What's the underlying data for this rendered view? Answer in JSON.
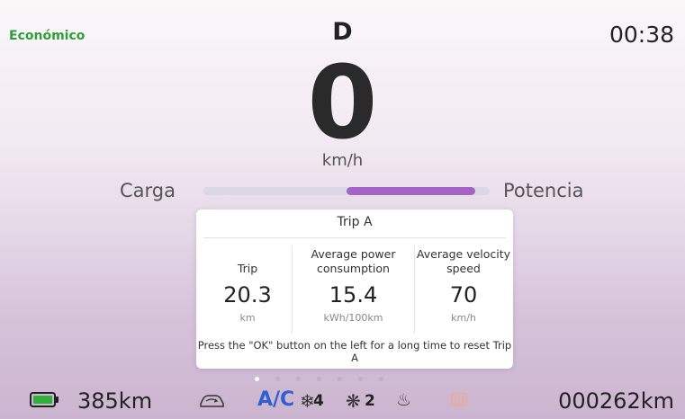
{
  "header": {
    "drive_mode": "Económico",
    "gear": "D",
    "clock": "00:38"
  },
  "speedometer": {
    "speed": "0",
    "unit": "km/h"
  },
  "power_meter": {
    "left_label": "Carga",
    "right_label": "Potencia",
    "power_fraction": 0.45,
    "fill_color": "#a464c6"
  },
  "trip_card": {
    "title": "Trip A",
    "columns": [
      {
        "label": "Trip",
        "value": "20.3",
        "unit": "km"
      },
      {
        "label": "Average power consumption",
        "value": "15.4",
        "unit": "kWh/100km"
      },
      {
        "label": "Average velocity speed",
        "value": "70",
        "unit": "km/h"
      }
    ],
    "hint": "Press the \"OK\" button on the left for a long time to reset Trip A"
  },
  "pager": {
    "page_count": 7,
    "active_index": 0
  },
  "status_bar": {
    "range": "385km",
    "battery_color": "#2fae3b",
    "ac_label": "A/C",
    "ac_color": "#2f5fd0",
    "fan_front_level": "4",
    "fan_rear_level": "2",
    "odometer": "000262km",
    "icons": [
      "battery-icon",
      "car-recirculation-icon",
      "snowflake-fan-icon",
      "fan-icon",
      "seat-heat-icon",
      "rear-defrost-icon"
    ]
  }
}
